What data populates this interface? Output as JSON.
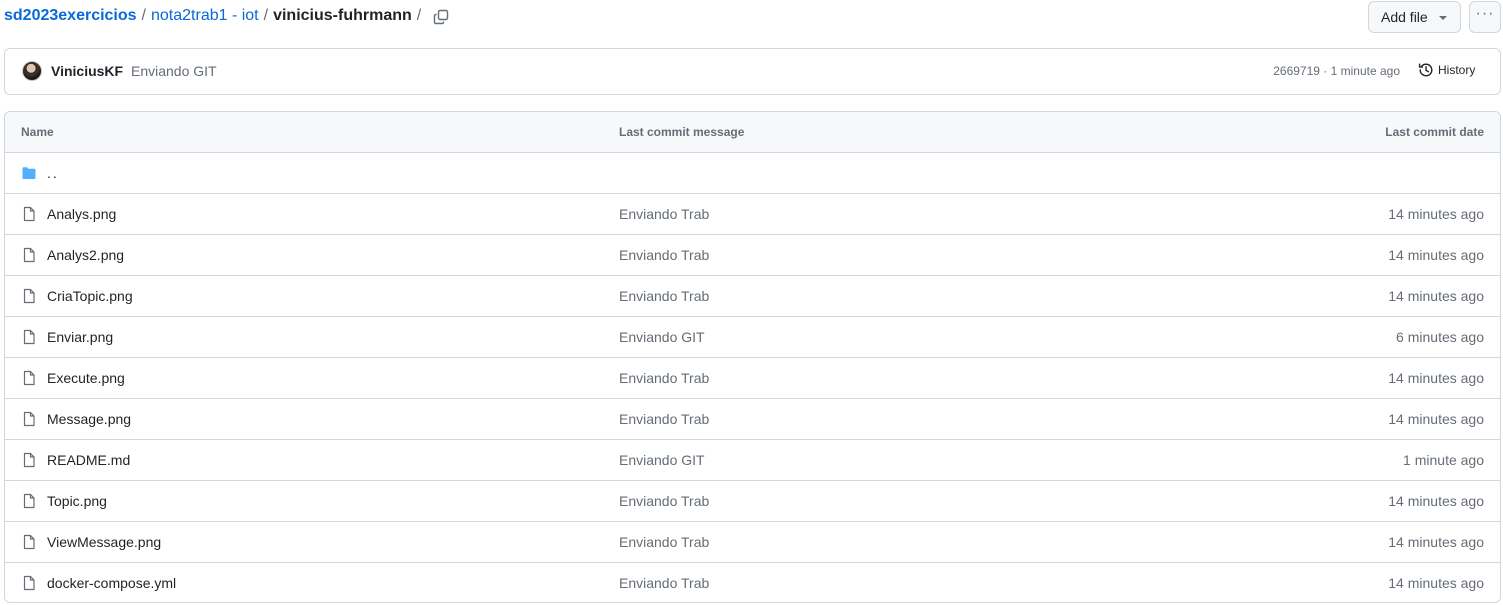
{
  "breadcrumb": {
    "repo": "sd2023exercicios",
    "folder": "nota2trab1 - iot",
    "current": "vinicius-fuhrmann",
    "separator": "/"
  },
  "actions": {
    "add_file": "Add file",
    "more": "···"
  },
  "latest_commit": {
    "author": "ViniciusKF",
    "message": "Enviando GIT",
    "meta": "2669719 · 1 minute ago",
    "history_label": "History"
  },
  "table": {
    "headers": {
      "name": "Name",
      "message": "Last commit message",
      "date": "Last commit date"
    },
    "parent": "..",
    "rows": [
      {
        "name": "Analys.png",
        "message": "Enviando Trab",
        "date": "14 minutes ago"
      },
      {
        "name": "Analys2.png",
        "message": "Enviando Trab",
        "date": "14 minutes ago"
      },
      {
        "name": "CriaTopic.png",
        "message": "Enviando Trab",
        "date": "14 minutes ago"
      },
      {
        "name": "Enviar.png",
        "message": "Enviando GIT",
        "date": "6 minutes ago"
      },
      {
        "name": "Execute.png",
        "message": "Enviando Trab",
        "date": "14 minutes ago"
      },
      {
        "name": "Message.png",
        "message": "Enviando Trab",
        "date": "14 minutes ago"
      },
      {
        "name": "README.md",
        "message": "Enviando GIT",
        "date": "1 minute ago"
      },
      {
        "name": "Topic.png",
        "message": "Enviando Trab",
        "date": "14 minutes ago"
      },
      {
        "name": "ViewMessage.png",
        "message": "Enviando Trab",
        "date": "14 minutes ago"
      },
      {
        "name": "docker-compose.yml",
        "message": "Enviando Trab",
        "date": "14 minutes ago"
      }
    ]
  },
  "icons": {
    "folder": "folder-icon",
    "file": "file-icon",
    "copy": "copy-icon",
    "history": "history-icon",
    "caret": "caret-down-icon"
  },
  "colors": {
    "link": "#0969da",
    "folder": "#54aeff",
    "muted": "#656d76",
    "border": "#d0d7de"
  }
}
